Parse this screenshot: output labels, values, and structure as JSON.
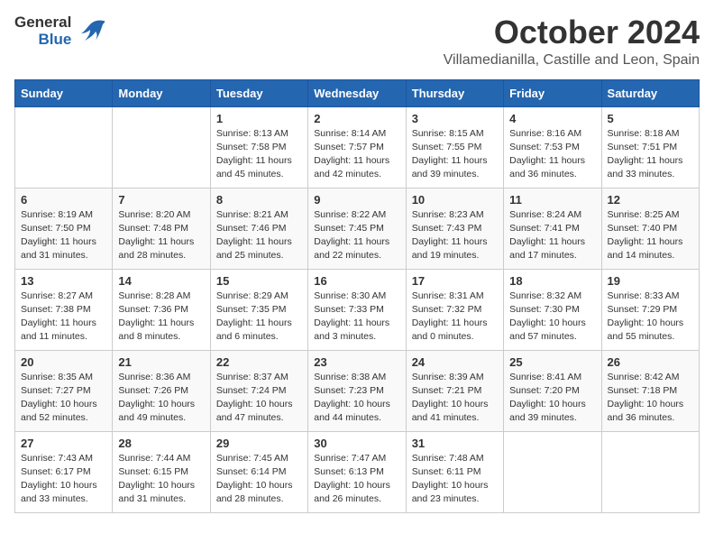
{
  "header": {
    "logo_general": "General",
    "logo_blue": "Blue",
    "month_title": "October 2024",
    "location": "Villamedianilla, Castille and Leon, Spain"
  },
  "days_of_week": [
    "Sunday",
    "Monday",
    "Tuesday",
    "Wednesday",
    "Thursday",
    "Friday",
    "Saturday"
  ],
  "weeks": [
    [
      {
        "day": "",
        "info": ""
      },
      {
        "day": "",
        "info": ""
      },
      {
        "day": "1",
        "info": "Sunrise: 8:13 AM\nSunset: 7:58 PM\nDaylight: 11 hours and 45 minutes."
      },
      {
        "day": "2",
        "info": "Sunrise: 8:14 AM\nSunset: 7:57 PM\nDaylight: 11 hours and 42 minutes."
      },
      {
        "day": "3",
        "info": "Sunrise: 8:15 AM\nSunset: 7:55 PM\nDaylight: 11 hours and 39 minutes."
      },
      {
        "day": "4",
        "info": "Sunrise: 8:16 AM\nSunset: 7:53 PM\nDaylight: 11 hours and 36 minutes."
      },
      {
        "day": "5",
        "info": "Sunrise: 8:18 AM\nSunset: 7:51 PM\nDaylight: 11 hours and 33 minutes."
      }
    ],
    [
      {
        "day": "6",
        "info": "Sunrise: 8:19 AM\nSunset: 7:50 PM\nDaylight: 11 hours and 31 minutes."
      },
      {
        "day": "7",
        "info": "Sunrise: 8:20 AM\nSunset: 7:48 PM\nDaylight: 11 hours and 28 minutes."
      },
      {
        "day": "8",
        "info": "Sunrise: 8:21 AM\nSunset: 7:46 PM\nDaylight: 11 hours and 25 minutes."
      },
      {
        "day": "9",
        "info": "Sunrise: 8:22 AM\nSunset: 7:45 PM\nDaylight: 11 hours and 22 minutes."
      },
      {
        "day": "10",
        "info": "Sunrise: 8:23 AM\nSunset: 7:43 PM\nDaylight: 11 hours and 19 minutes."
      },
      {
        "day": "11",
        "info": "Sunrise: 8:24 AM\nSunset: 7:41 PM\nDaylight: 11 hours and 17 minutes."
      },
      {
        "day": "12",
        "info": "Sunrise: 8:25 AM\nSunset: 7:40 PM\nDaylight: 11 hours and 14 minutes."
      }
    ],
    [
      {
        "day": "13",
        "info": "Sunrise: 8:27 AM\nSunset: 7:38 PM\nDaylight: 11 hours and 11 minutes."
      },
      {
        "day": "14",
        "info": "Sunrise: 8:28 AM\nSunset: 7:36 PM\nDaylight: 11 hours and 8 minutes."
      },
      {
        "day": "15",
        "info": "Sunrise: 8:29 AM\nSunset: 7:35 PM\nDaylight: 11 hours and 6 minutes."
      },
      {
        "day": "16",
        "info": "Sunrise: 8:30 AM\nSunset: 7:33 PM\nDaylight: 11 hours and 3 minutes."
      },
      {
        "day": "17",
        "info": "Sunrise: 8:31 AM\nSunset: 7:32 PM\nDaylight: 11 hours and 0 minutes."
      },
      {
        "day": "18",
        "info": "Sunrise: 8:32 AM\nSunset: 7:30 PM\nDaylight: 10 hours and 57 minutes."
      },
      {
        "day": "19",
        "info": "Sunrise: 8:33 AM\nSunset: 7:29 PM\nDaylight: 10 hours and 55 minutes."
      }
    ],
    [
      {
        "day": "20",
        "info": "Sunrise: 8:35 AM\nSunset: 7:27 PM\nDaylight: 10 hours and 52 minutes."
      },
      {
        "day": "21",
        "info": "Sunrise: 8:36 AM\nSunset: 7:26 PM\nDaylight: 10 hours and 49 minutes."
      },
      {
        "day": "22",
        "info": "Sunrise: 8:37 AM\nSunset: 7:24 PM\nDaylight: 10 hours and 47 minutes."
      },
      {
        "day": "23",
        "info": "Sunrise: 8:38 AM\nSunset: 7:23 PM\nDaylight: 10 hours and 44 minutes."
      },
      {
        "day": "24",
        "info": "Sunrise: 8:39 AM\nSunset: 7:21 PM\nDaylight: 10 hours and 41 minutes."
      },
      {
        "day": "25",
        "info": "Sunrise: 8:41 AM\nSunset: 7:20 PM\nDaylight: 10 hours and 39 minutes."
      },
      {
        "day": "26",
        "info": "Sunrise: 8:42 AM\nSunset: 7:18 PM\nDaylight: 10 hours and 36 minutes."
      }
    ],
    [
      {
        "day": "27",
        "info": "Sunrise: 7:43 AM\nSunset: 6:17 PM\nDaylight: 10 hours and 33 minutes."
      },
      {
        "day": "28",
        "info": "Sunrise: 7:44 AM\nSunset: 6:15 PM\nDaylight: 10 hours and 31 minutes."
      },
      {
        "day": "29",
        "info": "Sunrise: 7:45 AM\nSunset: 6:14 PM\nDaylight: 10 hours and 28 minutes."
      },
      {
        "day": "30",
        "info": "Sunrise: 7:47 AM\nSunset: 6:13 PM\nDaylight: 10 hours and 26 minutes."
      },
      {
        "day": "31",
        "info": "Sunrise: 7:48 AM\nSunset: 6:11 PM\nDaylight: 10 hours and 23 minutes."
      },
      {
        "day": "",
        "info": ""
      },
      {
        "day": "",
        "info": ""
      }
    ]
  ]
}
